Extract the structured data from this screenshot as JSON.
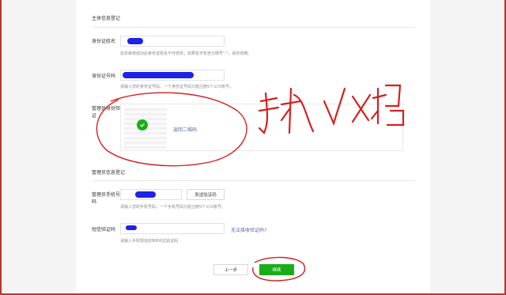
{
  "subject_section": {
    "title": "主体信息登记",
    "name_label": "身份证姓名",
    "name_hint": "信息审核成功后身份证姓名不可修改；如果名字包含分隔号\"·\"，请勿省略。",
    "id_label": "身份证号码",
    "id_hint": "请输入您的身份证号码。一个身份证号码只能注册5个公众账号。",
    "verify_label": "管理员身份验证",
    "qr_back": "返回二维码"
  },
  "admin_section": {
    "title": "管理员信息登记",
    "phone_label": "管理员手机号码",
    "send_code_button": "发送验证码",
    "phone_hint": "请输入您的手机号码，一个手机号码只能注册5个公众账号。",
    "sms_label": "短信验证码",
    "no_code_link": "无法接收验证码?",
    "sms_hint": "请输入手机短信收到的6位验证码"
  },
  "footer": {
    "prev_button": "上一步",
    "continue_button": "继续"
  },
  "colors": {
    "primary": "#1aad19",
    "link": "#576b95",
    "annotation": "#d42020",
    "redaction": "#1f23e6"
  }
}
